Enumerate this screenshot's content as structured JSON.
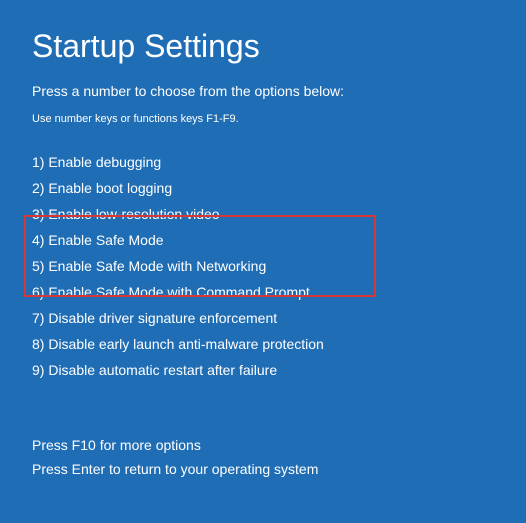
{
  "title": "Startup Settings",
  "subtitle": "Press a number to choose from the options below:",
  "hint": "Use number keys or functions keys F1-F9.",
  "options": [
    "1) Enable debugging",
    "2) Enable boot logging",
    "3) Enable low-resolution video",
    "4) Enable Safe Mode",
    "5) Enable Safe Mode with Networking",
    "6) Enable Safe Mode with Command Prompt",
    "7) Disable driver signature enforcement",
    "8) Disable early launch anti-malware protection",
    "9) Disable automatic restart after failure"
  ],
  "footer": {
    "more_options": "Press F10 for more options",
    "return": "Press Enter to return to your operating system"
  }
}
